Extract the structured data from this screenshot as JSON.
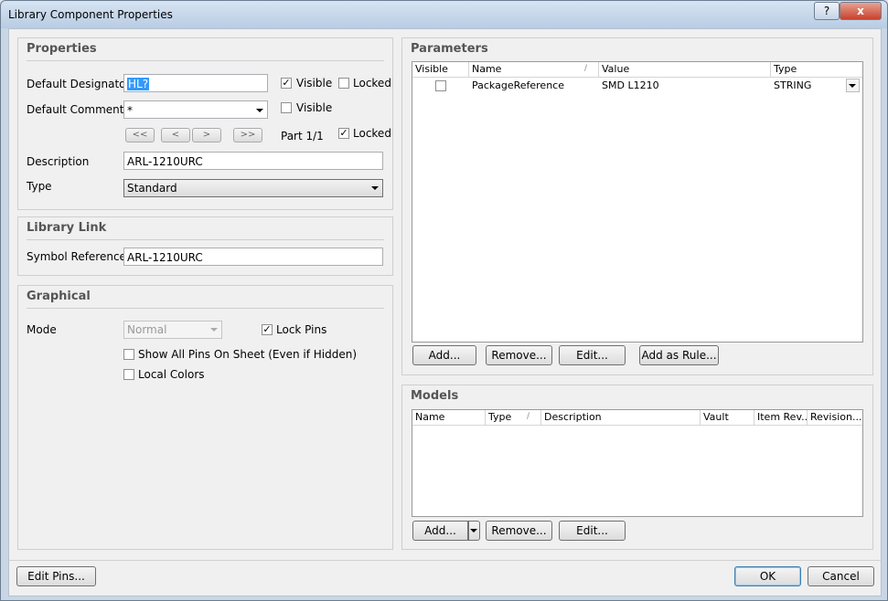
{
  "window": {
    "title": "Library Component Properties",
    "help_label": "?",
    "close_label": "x"
  },
  "properties": {
    "title": "Properties",
    "default_designator_label": "Default Designator",
    "default_designator_value": "HL?",
    "designator_visible_label": "Visible",
    "designator_locked_label": "Locked",
    "default_comment_label": "Default Comment",
    "default_comment_value": "*",
    "comment_visible_label": "Visible",
    "nav": [
      "<<",
      "<",
      ">",
      ">>"
    ],
    "part_label": "Part 1/1",
    "part_locked_label": "Locked",
    "description_label": "Description",
    "description_value": "ARL-1210URC",
    "type_label": "Type",
    "type_value": "Standard"
  },
  "library_link": {
    "title": "Library Link",
    "symbol_reference_label": "Symbol Reference",
    "symbol_reference_value": "ARL-1210URC"
  },
  "graphical": {
    "title": "Graphical",
    "mode_label": "Mode",
    "mode_value": "Normal",
    "lock_pins_label": "Lock Pins",
    "show_all_pins_label": "Show All Pins On Sheet (Even if Hidden)",
    "local_colors_label": "Local Colors"
  },
  "parameters": {
    "title": "Parameters",
    "columns": [
      "Visible",
      "Name",
      "Value",
      "Type"
    ],
    "rows": [
      {
        "visible": false,
        "name": "PackageReference",
        "value": "SMD L1210",
        "type": "STRING"
      }
    ],
    "buttons": {
      "add": "Add...",
      "remove": "Remove...",
      "edit": "Edit...",
      "add_as_rule": "Add as Rule..."
    }
  },
  "models": {
    "title": "Models",
    "columns": [
      "Name",
      "Type",
      "Description",
      "Vault",
      "Item Rev...",
      "Revision..."
    ],
    "buttons": {
      "add": "Add...",
      "remove": "Remove...",
      "edit": "Edit..."
    }
  },
  "footer": {
    "edit_pins": "Edit Pins...",
    "ok": "OK",
    "cancel": "Cancel"
  },
  "checkmark": "✓"
}
